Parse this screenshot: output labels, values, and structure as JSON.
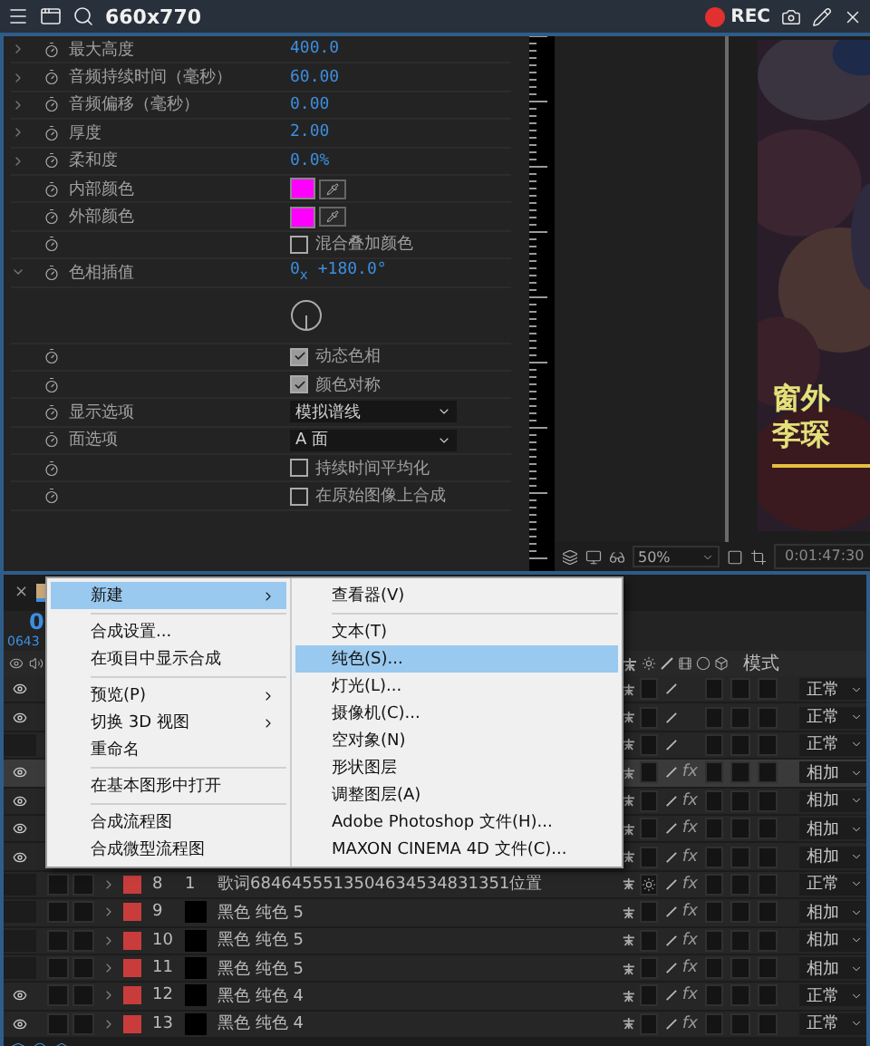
{
  "title_bar": {
    "title": "660x770",
    "rec": "REC"
  },
  "effect_controls": {
    "properties": [
      {
        "kind": "value",
        "label": "最大高度",
        "value": "400.0",
        "expanded": false
      },
      {
        "kind": "value",
        "label": "音频持续时间（毫秒）",
        "value": "60.00",
        "expanded": false
      },
      {
        "kind": "value",
        "label": "音频偏移（毫秒）",
        "value": "0.00",
        "expanded": false
      },
      {
        "kind": "value",
        "label": "厚度",
        "value": "2.00",
        "expanded": false
      },
      {
        "kind": "value",
        "label": "柔和度",
        "value": "0.0%",
        "expanded": false
      },
      {
        "kind": "color",
        "label": "内部颜色",
        "color": "#ff00ff"
      },
      {
        "kind": "color",
        "label": "外部颜色",
        "color": "#ff00ff"
      },
      {
        "kind": "checkbox",
        "text": "混合叠加颜色",
        "checked": false
      },
      {
        "kind": "angle",
        "label": "色相插值",
        "value": "0$_{x}$ +180.0°",
        "expanded": true
      },
      {
        "kind": "checkbox",
        "text": "动态色相",
        "checked": true
      },
      {
        "kind": "checkbox",
        "text": "颜色对称",
        "checked": true
      },
      {
        "kind": "dropdown",
        "label": "显示选项",
        "value": "模拟谱线"
      },
      {
        "kind": "dropdown",
        "label": "面选项",
        "value": "A 面"
      },
      {
        "kind": "checkbox",
        "text": "持续时间平均化",
        "checked": false
      },
      {
        "kind": "checkbox",
        "text": "在原始图像上合成",
        "checked": false
      }
    ]
  },
  "viewer": {
    "caption": [
      "窗外",
      "李琛"
    ],
    "zoom": "50%",
    "timecode": "0:01:47:30"
  },
  "timeline": {
    "close": "×",
    "timecode": "0",
    "frame": "0643",
    "mode_header": "模式",
    "layers": [
      {
        "visible": true,
        "selected": false,
        "mode": "正常"
      },
      {
        "visible": true,
        "selected": false,
        "mode": "正常"
      },
      {
        "visible": false,
        "selected": false,
        "mode": "正常"
      },
      {
        "visible": true,
        "selected": true,
        "mode": "相加",
        "fx": "fx"
      },
      {
        "visible": true,
        "selected": false,
        "mode": "相加",
        "fx": "fx"
      },
      {
        "visible": true,
        "selected": false,
        "mode": "相加",
        "fx": "fx"
      },
      {
        "visible": true,
        "selected": false,
        "mode": "相加",
        "fx": "fx"
      },
      {
        "visible": false,
        "selected": false,
        "mode": "正常",
        "fx": "fx",
        "sun_switch": true,
        "number": "8",
        "parent": "1",
        "name": "歌词6846455513504634534831351位置",
        "color": "#c83c3c"
      },
      {
        "visible": false,
        "selected": false,
        "mode": "相加",
        "fx": "fx",
        "number": "9",
        "name": "黑色 纯色 5",
        "color": "#c83c3c"
      },
      {
        "visible": false,
        "selected": false,
        "mode": "相加",
        "fx": "fx",
        "number": "10",
        "name": "黑色 纯色 5",
        "color": "#c83c3c"
      },
      {
        "visible": false,
        "selected": false,
        "mode": "相加",
        "fx": "fx",
        "number": "11",
        "name": "黑色 纯色 5",
        "color": "#c83c3c"
      },
      {
        "visible": true,
        "selected": false,
        "mode": "正常",
        "fx": "fx",
        "number": "12",
        "name": "黑色 纯色 4",
        "color": "#c83c3c"
      },
      {
        "visible": true,
        "selected": false,
        "mode": "正常",
        "fx": "fx",
        "number": "13",
        "name": "黑色 纯色 4",
        "color": "#c83c3c"
      }
    ]
  },
  "context_menu": {
    "items": [
      {
        "kind": "item",
        "label": "新建",
        "submenu": true,
        "selected": true
      },
      {
        "kind": "separator"
      },
      {
        "kind": "item",
        "label": "合成设置...",
        "submenu": false,
        "selected": false
      },
      {
        "kind": "item",
        "label": "在项目中显示合成",
        "submenu": false,
        "selected": false
      },
      {
        "kind": "separator"
      },
      {
        "kind": "item",
        "label": "预览(P)",
        "submenu": true,
        "selected": false
      },
      {
        "kind": "item",
        "label": "切换 3D 视图",
        "submenu": true,
        "selected": false
      },
      {
        "kind": "item",
        "label": "重命名",
        "submenu": false,
        "selected": false
      },
      {
        "kind": "separator"
      },
      {
        "kind": "item",
        "label": "在基本图形中打开",
        "submenu": false,
        "selected": false
      },
      {
        "kind": "separator"
      },
      {
        "kind": "item",
        "label": "合成流程图",
        "submenu": false,
        "selected": false
      },
      {
        "kind": "item",
        "label": "合成微型流程图",
        "submenu": false,
        "selected": false
      }
    ],
    "submenu": [
      {
        "kind": "item",
        "label": "查看器(V)",
        "selected": false
      },
      {
        "kind": "separator"
      },
      {
        "kind": "item",
        "label": "文本(T)",
        "selected": false
      },
      {
        "kind": "item",
        "label": "纯色(S)...",
        "selected": true
      },
      {
        "kind": "item",
        "label": "灯光(L)...",
        "selected": false
      },
      {
        "kind": "item",
        "label": "摄像机(C)...",
        "selected": false
      },
      {
        "kind": "item",
        "label": "空对象(N)",
        "selected": false
      },
      {
        "kind": "item",
        "label": "形状图层",
        "selected": false
      },
      {
        "kind": "item",
        "label": "调整图层(A)",
        "selected": false
      },
      {
        "kind": "item",
        "label": "Adobe Photoshop 文件(H)...",
        "selected": false
      },
      {
        "kind": "item",
        "label": "MAXON CINEMA 4D 文件(C)...",
        "selected": false
      }
    ]
  }
}
